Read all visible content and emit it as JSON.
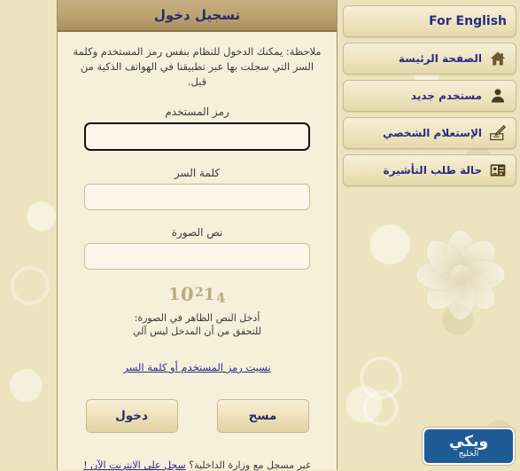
{
  "panel": {
    "title": "تسجيل دخول",
    "note": "ملاحظة: يمكنك الدخول للنظام بنفس رمز المستخدم وكلمة السر التي سجلت بها عبر تطبيقنا في الهواتف الذكية من قبل."
  },
  "form": {
    "username_label": "رمز المستخدم",
    "username_value": "",
    "username_placeholder": "",
    "password_label": "كلمة السر",
    "password_value": "",
    "password_placeholder": "",
    "captcha_label": "نص الصورة",
    "captcha_value": "",
    "captcha_placeholder": "",
    "captcha_image_text": "10214",
    "captcha_hint_line1": "أدخل النص الظاهر في الصورة:",
    "captcha_hint_line2": "للتحقق من أن المدخل ليس آلي",
    "forgot_link": "نسيت رمز المستخدم أو كلمة السر",
    "submit_label": "دخول",
    "clear_label": "مسح"
  },
  "register": {
    "question": "غير مسجل مع وزارة الداخلية؟",
    "link": "سجل على الانترنت الآن !"
  },
  "sidebar": {
    "items": [
      {
        "label": "For English",
        "icon": "none"
      },
      {
        "label": "الصفحة الرئيسة",
        "icon": "home-icon"
      },
      {
        "label": "مستخدم جديد",
        "icon": "user-icon"
      },
      {
        "label": "الإستعلام الشخصي",
        "icon": "inquiry-icon"
      },
      {
        "label": "حالة طلب التأشيرة",
        "icon": "id-card-icon"
      }
    ]
  },
  "watermark": {
    "main": "ويكي",
    "sub": "الخليج"
  },
  "colors": {
    "page_background": "#ece4be",
    "panel_background": "#f6f0db",
    "title_bar": "#bda471",
    "link": "#2a2a86",
    "button_text": "#2b2b6b",
    "watermark_badge": "#1f5c96"
  }
}
